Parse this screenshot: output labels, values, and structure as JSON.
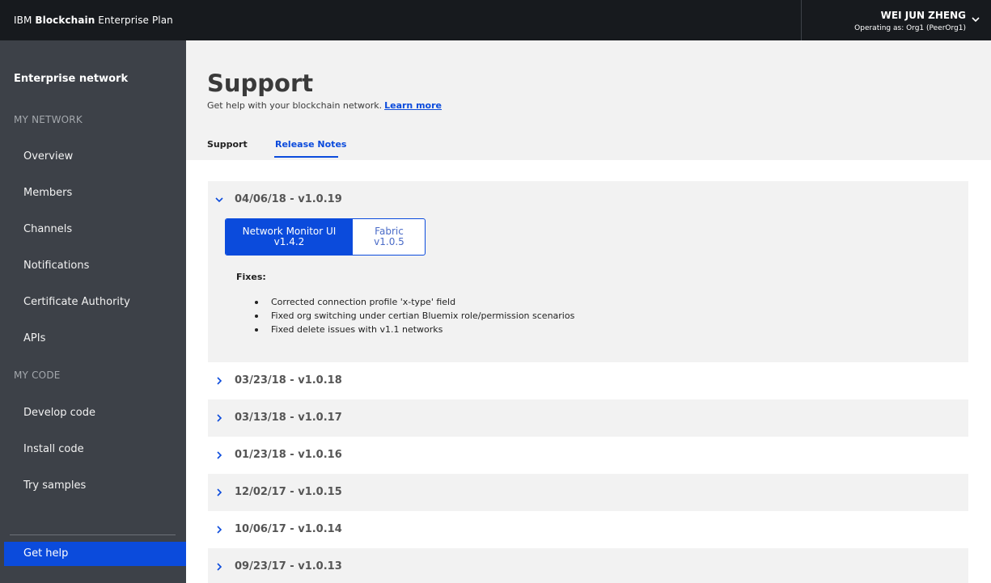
{
  "topbar": {
    "brand_prefix": "IBM",
    "brand_bold": "Blockchain",
    "brand_suffix": "Enterprise Plan",
    "user_name": "WEI JUN ZHENG",
    "user_role": "Operating as: Org1 (PeerOrg1)"
  },
  "sidebar": {
    "title": "Enterprise network",
    "section_network": "MY NETWORK",
    "network_items": [
      "Overview",
      "Members",
      "Channels",
      "Notifications",
      "Certificate Authority",
      "APIs"
    ],
    "section_code": "MY CODE",
    "code_items": [
      "Develop code",
      "Install code",
      "Try samples"
    ],
    "get_help": "Get help"
  },
  "main": {
    "title": "Support",
    "subtitle": "Get help with your blockchain network.",
    "learn_more": "Learn more",
    "tabs": [
      "Support",
      "Release Notes"
    ],
    "active_tab": "Release Notes"
  },
  "releases": {
    "expanded": {
      "version": "04/06/18 - v1.0.19",
      "toggle_left_line1": "Network Monitor UI",
      "toggle_left_line2": "v1.4.2",
      "toggle_right_line1": "Fabric",
      "toggle_right_line2": "v1.0.5",
      "fixes_label": "Fixes:",
      "fixes": [
        "Corrected connection profile 'x-type' field",
        "Fixed org switching under certian Bluemix role/permission scenarios",
        "Fixed delete issues with v1.1 networks"
      ]
    },
    "collapsed": [
      "03/23/18 - v1.0.18",
      "03/13/18 - v1.0.17",
      "01/23/18 - v1.0.16",
      "12/02/17 - v1.0.15",
      "10/06/17 - v1.0.14",
      "09/23/17 - v1.0.13"
    ]
  },
  "colors": {
    "topbar": "#171a1e",
    "sidebar": "#3d4148",
    "accent": "#0b4bdc"
  }
}
